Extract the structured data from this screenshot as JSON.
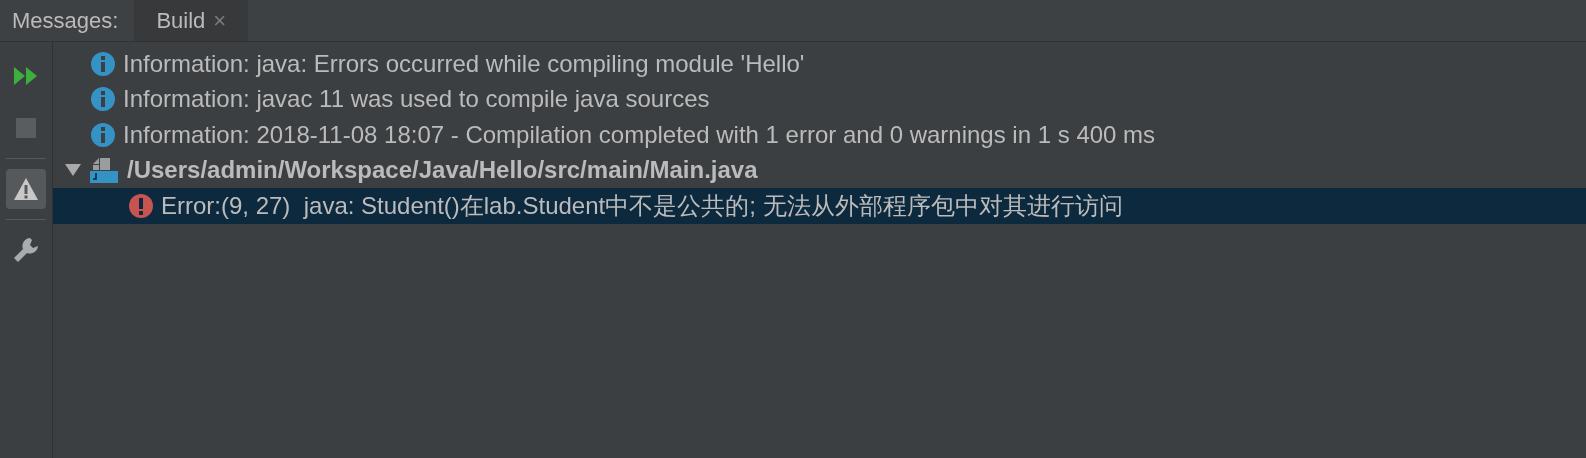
{
  "header": {
    "label": "Messages:",
    "tabs": [
      {
        "label": "Build",
        "close": "×",
        "selected": true
      }
    ]
  },
  "toolbar": [
    {
      "kind": "rerun",
      "on": false
    },
    {
      "kind": "stop",
      "on": false
    },
    {
      "kind": "warnings",
      "on": true
    },
    {
      "kind": "settings",
      "on": false
    }
  ],
  "messages": [
    {
      "kind": "info",
      "text": "Information: java: Errors occurred while compiling module 'Hello'",
      "selected": false
    },
    {
      "kind": "info",
      "text": "Information: javac 11 was used to compile java sources",
      "selected": false
    },
    {
      "kind": "info",
      "text": "Information: 2018-11-08 18:07 - Compilation completed with 1 error and 0 warnings in 1 s 400 ms",
      "selected": false
    },
    {
      "kind": "file",
      "text": "/Users/admin/Workspace/Java/Hello/src/main/Main.java",
      "expanded": true,
      "selected": false,
      "children": [
        {
          "kind": "error",
          "text": "Error:(9, 27)  java: Student()在lab.Student中不是公共的; 无法从外部程序包中对其进行访问",
          "selected": true
        }
      ]
    }
  ]
}
